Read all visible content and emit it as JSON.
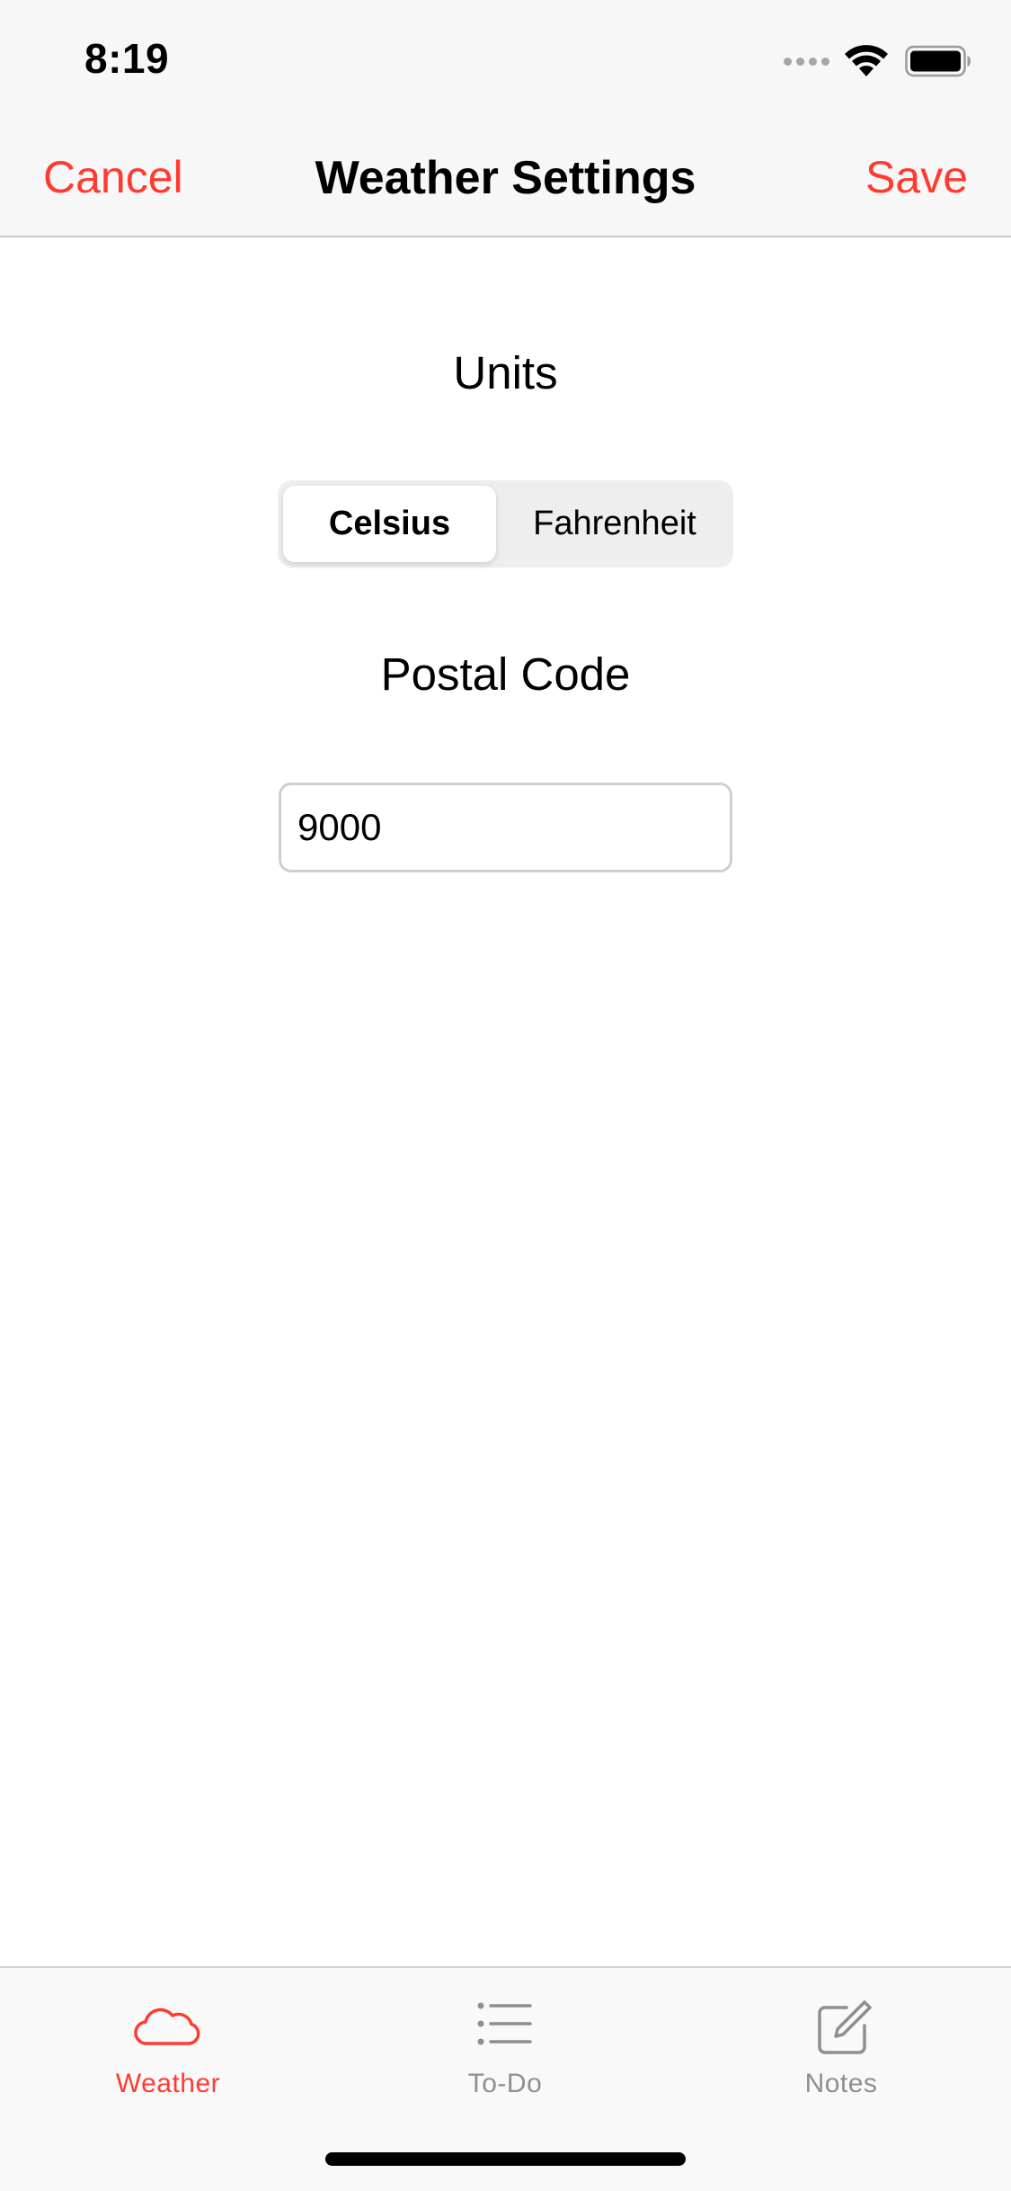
{
  "status_bar": {
    "time": "8:19"
  },
  "nav": {
    "cancel_label": "Cancel",
    "title": "Weather Settings",
    "save_label": "Save",
    "accent_color": "#ff3b30"
  },
  "units": {
    "label": "Units",
    "options": [
      "Celsius",
      "Fahrenheit"
    ],
    "selected": "Celsius"
  },
  "postal": {
    "label": "Postal Code",
    "value": "9000"
  },
  "tab_bar": {
    "items": [
      {
        "label": "Weather",
        "icon": "cloud-icon",
        "active": true
      },
      {
        "label": "To-Do",
        "icon": "list-icon",
        "active": false
      },
      {
        "label": "Notes",
        "icon": "compose-icon",
        "active": false
      }
    ],
    "active_color": "#ff3b30",
    "inactive_color": "#8e8e93"
  }
}
